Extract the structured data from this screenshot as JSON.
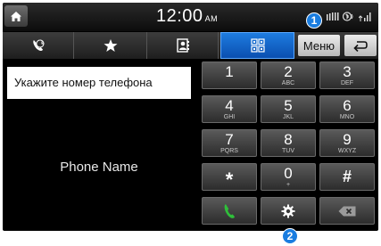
{
  "status": {
    "time": "12:00",
    "ampm": "AM"
  },
  "tabs": {
    "menu_label": "Меню"
  },
  "left_panel": {
    "phone_placeholder": "Укажите номер телефона",
    "phone_name": "Phone Name"
  },
  "keypad": {
    "k1": {
      "num": "1",
      "letters": ""
    },
    "k2": {
      "num": "2",
      "letters": "ABC"
    },
    "k3": {
      "num": "3",
      "letters": "DEF"
    },
    "k4": {
      "num": "4",
      "letters": "GHI"
    },
    "k5": {
      "num": "5",
      "letters": "JKL"
    },
    "k6": {
      "num": "6",
      "letters": "MNO"
    },
    "k7": {
      "num": "7",
      "letters": "PQRS"
    },
    "k8": {
      "num": "8",
      "letters": "TUV"
    },
    "k9": {
      "num": "9",
      "letters": "WXYZ"
    },
    "kstar": {
      "num": "*",
      "letters": ""
    },
    "k0": {
      "num": "0",
      "letters": "+"
    },
    "khash": {
      "num": "#",
      "letters": ""
    }
  },
  "callouts": {
    "c1": "1",
    "c2": "2"
  },
  "colors": {
    "accent_blue": "#1a7de0",
    "call_green": "#2fbf3a"
  },
  "icons": {
    "home": "home-icon",
    "recent_calls": "recent-calls-icon",
    "favorites": "star-icon",
    "contacts": "contacts-icon",
    "keypad": "keypad-icon",
    "back": "back-icon",
    "call": "phone-handset-icon",
    "settings": "gear-icon",
    "delete": "backspace-icon"
  }
}
